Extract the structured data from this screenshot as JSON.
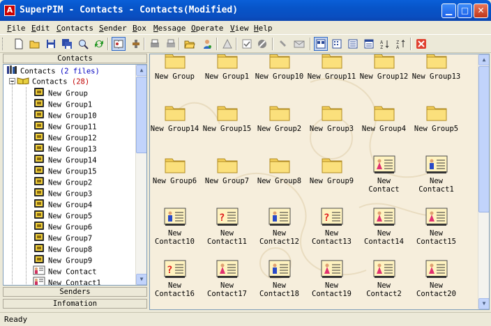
{
  "window": {
    "title": "SuperPIM - Contacts - Contacts(Modified)",
    "app_icon_letter": "A"
  },
  "menu": [
    "File",
    "Edit",
    "Contacts",
    "Sender",
    "Box",
    "Message",
    "Operate",
    "View",
    "Help"
  ],
  "toolbar_icons": [
    "new-icon",
    "open-icon",
    "save-icon",
    "save-all-icon",
    "search-icon",
    "refresh-icon",
    "book-icon",
    "tools-icon",
    "print-icon",
    "print-preview-icon",
    "folder-open-icon",
    "user-icon",
    "send-icon",
    "check-icon",
    "stop-icon",
    "attach-icon",
    "envelope-icon",
    "large-icons-view-icon",
    "small-icons-view-icon",
    "list-view-icon",
    "details-view-icon",
    "sort-asc-icon",
    "sort-desc-icon",
    "delete-icon"
  ],
  "left_panel": {
    "header": "Contacts",
    "root": {
      "label": "Contacts",
      "count": "(2 files)"
    },
    "folder": {
      "label": "Contacts",
      "count": "(28)"
    },
    "items": [
      {
        "label": "New Group",
        "type": "group"
      },
      {
        "label": "New Group1",
        "type": "group"
      },
      {
        "label": "New Group10",
        "type": "group"
      },
      {
        "label": "New Group11",
        "type": "group"
      },
      {
        "label": "New Group12",
        "type": "group"
      },
      {
        "label": "New Group13",
        "type": "group"
      },
      {
        "label": "New Group14",
        "type": "group"
      },
      {
        "label": "New Group15",
        "type": "group"
      },
      {
        "label": "New Group2",
        "type": "group"
      },
      {
        "label": "New Group3",
        "type": "group"
      },
      {
        "label": "New Group4",
        "type": "group"
      },
      {
        "label": "New Group5",
        "type": "group"
      },
      {
        "label": "New Group6",
        "type": "group"
      },
      {
        "label": "New Group7",
        "type": "group"
      },
      {
        "label": "New Group8",
        "type": "group"
      },
      {
        "label": "New Group9",
        "type": "group"
      },
      {
        "label": "New Contact",
        "type": "contact"
      },
      {
        "label": "New Contact1",
        "type": "contact"
      }
    ],
    "sections": [
      "Senders",
      "Infomation"
    ]
  },
  "grid_items": [
    {
      "label": "New Group",
      "type": "folder"
    },
    {
      "label": "New Group1",
      "type": "folder"
    },
    {
      "label": "New Group10",
      "type": "folder"
    },
    {
      "label": "New Group11",
      "type": "folder"
    },
    {
      "label": "New Group12",
      "type": "folder"
    },
    {
      "label": "New Group13",
      "type": "folder"
    },
    {
      "label": "New Group14",
      "type": "folder"
    },
    {
      "label": "New Group15",
      "type": "folder"
    },
    {
      "label": "New Group2",
      "type": "folder"
    },
    {
      "label": "New Group3",
      "type": "folder"
    },
    {
      "label": "New Group4",
      "type": "folder"
    },
    {
      "label": "New Group5",
      "type": "folder"
    },
    {
      "label": "New Group6",
      "type": "folder"
    },
    {
      "label": "New Group7",
      "type": "folder"
    },
    {
      "label": "New Group8",
      "type": "folder"
    },
    {
      "label": "New Group9",
      "type": "folder"
    },
    {
      "label": "New Contact",
      "type": "contact-female"
    },
    {
      "label": "New Contact1",
      "type": "contact-male"
    },
    {
      "label": "New Contact10",
      "type": "contact-male"
    },
    {
      "label": "New Contact11",
      "type": "contact-unknown"
    },
    {
      "label": "New Contact12",
      "type": "contact-male"
    },
    {
      "label": "New Contact13",
      "type": "contact-unknown"
    },
    {
      "label": "New Contact14",
      "type": "contact-female"
    },
    {
      "label": "New Contact15",
      "type": "contact-female"
    },
    {
      "label": "New Contact16",
      "type": "contact-unknown"
    },
    {
      "label": "New Contact17",
      "type": "contact-female"
    },
    {
      "label": "New Contact18",
      "type": "contact-male"
    },
    {
      "label": "New Contact19",
      "type": "contact-female"
    },
    {
      "label": "New Contact2",
      "type": "contact-female"
    },
    {
      "label": "New Contact20",
      "type": "contact-female"
    }
  ],
  "status": "Ready"
}
